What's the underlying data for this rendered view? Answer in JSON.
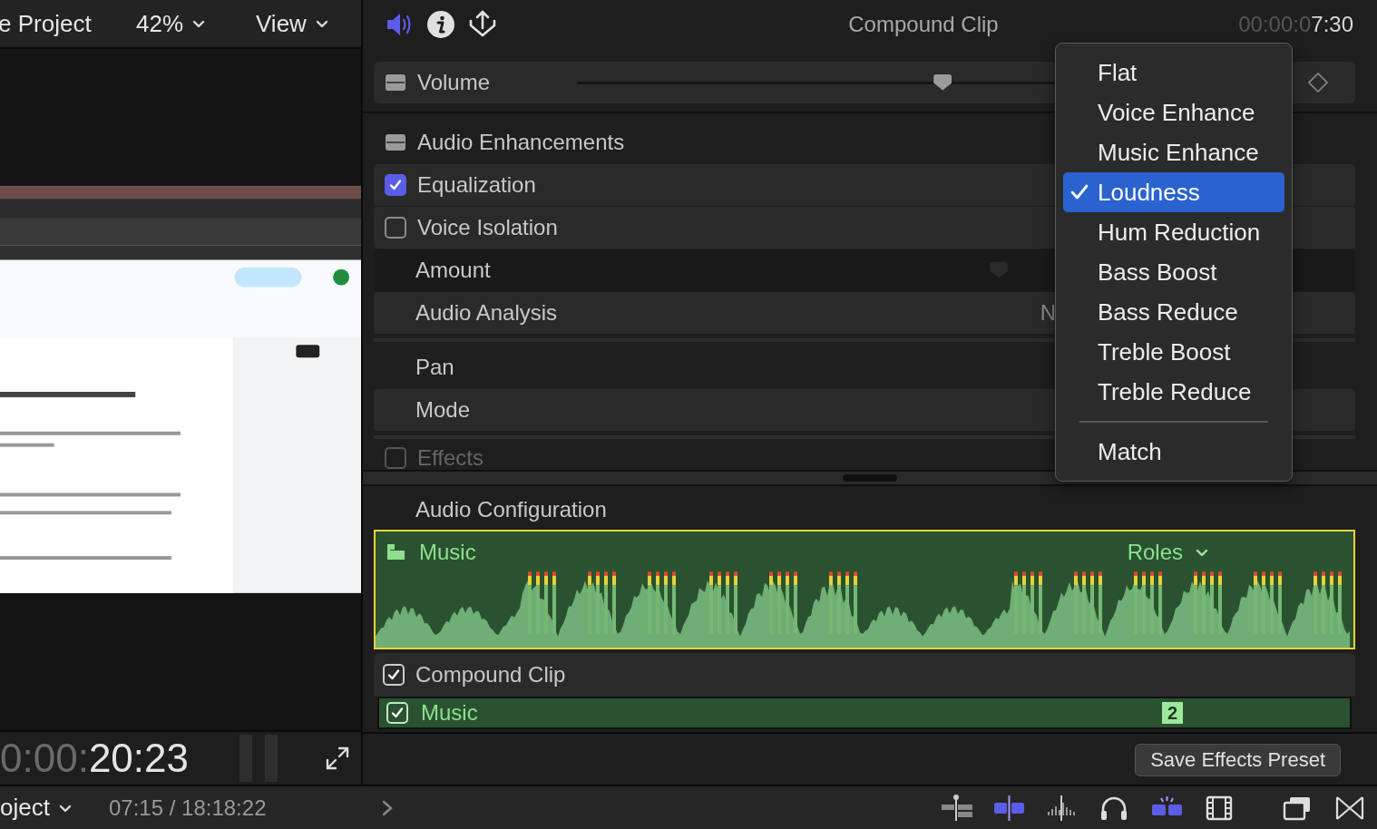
{
  "viewer": {
    "project": "e Project",
    "zoom": "42%",
    "view": "View",
    "timecode_dim": "0:00:",
    "timecode": "20:23"
  },
  "footer": {
    "project": "oject",
    "time": "07:15 / 18:18:22"
  },
  "inspector": {
    "tabs": [
      {
        "kind": "audio",
        "selected": true
      },
      {
        "kind": "info",
        "selected": false
      },
      {
        "kind": "share",
        "selected": false
      }
    ],
    "title": "Compound Clip",
    "timecode_dim": "00:00:0",
    "timecode": "7:30",
    "volume": {
      "label": "Volume",
      "level": 0.56
    },
    "enhancements": {
      "label": "Audio Enhancements",
      "rows": [
        {
          "kind": "check",
          "label": "Equalization",
          "checked": true
        },
        {
          "kind": "check",
          "label": "Voice Isolation",
          "checked": false
        },
        {
          "kind": "slider",
          "label": "Amount"
        },
        {
          "kind": "value",
          "label": "Audio Analysis",
          "value": "N"
        }
      ]
    },
    "pan": {
      "label": "Pan",
      "rows": [
        {
          "label": "Mode"
        }
      ]
    },
    "effects": {
      "label": "Effects",
      "checked": false
    },
    "audio_configuration": {
      "label": "Audio Configuration",
      "role_clip": {
        "label": "Music",
        "roles": "Roles",
        "selected": true
      },
      "compound": {
        "label": "Compound Clip",
        "checked": true
      },
      "sub_clip": {
        "label": "Music",
        "checked": true,
        "badge": "2"
      }
    },
    "save_button": "Save Effects Preset"
  },
  "menu": {
    "items": [
      {
        "kind": "item",
        "label": "Flat",
        "selected": false
      },
      {
        "kind": "item",
        "label": "Voice Enhance",
        "selected": false
      },
      {
        "kind": "item",
        "label": "Music Enhance",
        "selected": false
      },
      {
        "kind": "item",
        "label": "Loudness",
        "selected": true
      },
      {
        "kind": "item",
        "label": "Hum Reduction",
        "selected": false
      },
      {
        "kind": "item",
        "label": "Bass Boost",
        "selected": false
      },
      {
        "kind": "item",
        "label": "Bass Reduce",
        "selected": false
      },
      {
        "kind": "item",
        "label": "Treble Boost",
        "selected": false
      },
      {
        "kind": "item",
        "label": "Treble Reduce",
        "selected": false
      },
      {
        "kind": "separator"
      },
      {
        "kind": "item",
        "label": "Match",
        "selected": false
      }
    ]
  }
}
